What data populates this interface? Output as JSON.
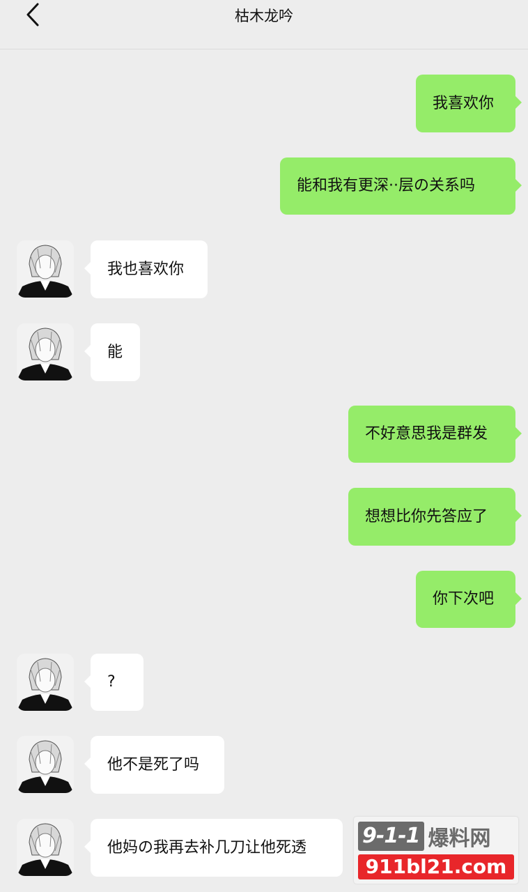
{
  "header": {
    "title": "枯木龙吟",
    "back_icon": "chevron-left-icon"
  },
  "messages": [
    {
      "from": "me",
      "text": "我喜欢你"
    },
    {
      "from": "me",
      "text": "能和我有更深··层の关系吗"
    },
    {
      "from": "other",
      "text": "我也喜欢你"
    },
    {
      "from": "other",
      "text": "能"
    },
    {
      "from": "me",
      "text": "不好意思我是群发"
    },
    {
      "from": "me",
      "text": "想想比你先答应了"
    },
    {
      "from": "me",
      "text": "你下次吧"
    },
    {
      "from": "other",
      "text": "?"
    },
    {
      "from": "other",
      "text": "他不是死了吗"
    },
    {
      "from": "other",
      "text": "他妈の我再去补几刀让他死透"
    }
  ],
  "colors": {
    "background": "#ededed",
    "my_bubble": "#95ec69",
    "other_bubble": "#ffffff"
  },
  "watermark": {
    "logo": "9-1-1",
    "site_name": "爆料网",
    "domain": "911bl21.com"
  }
}
